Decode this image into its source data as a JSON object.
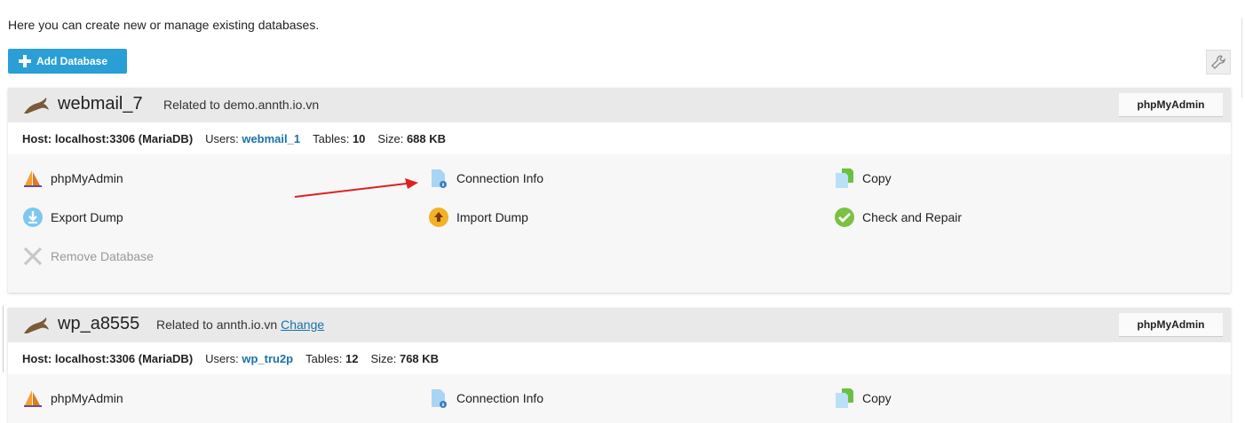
{
  "intro": "Here you can create new or manage existing databases.",
  "toolbar": {
    "add_label": "Add Database"
  },
  "databases": [
    {
      "name": "webmail_7",
      "related_prefix": "Related to demo.annth.io.vn",
      "change_link": "",
      "pma_button": "phpMyAdmin",
      "host": "Host: localhost:3306 (MariaDB)",
      "users_label": "Users:",
      "user": "webmail_1",
      "tables_label": "Tables:",
      "tables": "10",
      "size_label": "Size:",
      "size": "688 KB",
      "actions": {
        "phpmyadmin": "phpMyAdmin",
        "connection_info": "Connection Info",
        "copy": "Copy",
        "export_dump": "Export Dump",
        "import_dump": "Import Dump",
        "check_repair": "Check and Repair",
        "remove": "Remove Database"
      }
    },
    {
      "name": "wp_a8555",
      "related_prefix": "Related to annth.io.vn",
      "change_link": "Change",
      "pma_button": "phpMyAdmin",
      "host": "Host: localhost:3306 (MariaDB)",
      "users_label": "Users:",
      "user": "wp_tru2p",
      "tables_label": "Tables:",
      "tables": "12",
      "size_label": "Size:",
      "size": "768 KB",
      "actions": {
        "phpmyadmin": "phpMyAdmin",
        "connection_info": "Connection Info",
        "copy": "Copy"
      }
    }
  ],
  "icons": {
    "add": "plus-icon",
    "tools": "wrench-icon",
    "db": "mysql-dolphin-icon",
    "phpmyadmin": "phpmyadmin-sail-icon",
    "connection_info": "document-info-icon",
    "copy": "copy-documents-icon",
    "export": "download-circle-icon",
    "import": "upload-circle-icon",
    "check": "check-circle-icon",
    "remove": "x-icon"
  },
  "colors": {
    "accent": "#2a9fd6",
    "link": "#1a72a8",
    "annotation_arrow": "#e02020"
  }
}
